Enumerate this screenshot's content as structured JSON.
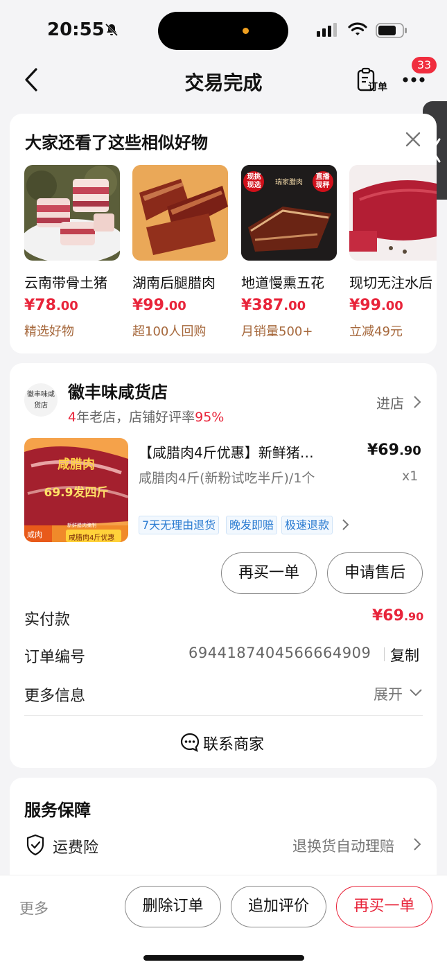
{
  "status_bar": {
    "time": "20:55"
  },
  "header": {
    "title": "交易完成",
    "order_label": "订单",
    "notification_count": "33"
  },
  "recommendations": {
    "title": "大家还看了这些相似好物",
    "items": [
      {
        "name": "云南带骨土猪",
        "price_int": "¥78",
        "price_dec": ".00",
        "tag": "精选好物"
      },
      {
        "name": "湖南后腿腊肉",
        "price_int": "¥99",
        "price_dec": ".00",
        "tag": "超100人回购"
      },
      {
        "name": "地道慢熏五花",
        "price_int": "¥387",
        "price_dec": ".00",
        "tag": "月销量500+",
        "badge_left": "现挑\n现选",
        "badge_mid": "瑞家腊肉",
        "badge_right": "直播\n现秤"
      },
      {
        "name": "现切无注水后",
        "price_int": "¥99",
        "price_dec": ".00",
        "tag": "立减49元"
      }
    ]
  },
  "order": {
    "shop": {
      "logo_text": "徽丰味咸货店",
      "name": "徽丰味咸货店",
      "years": "4",
      "years_text": "年老店，店铺好评率",
      "rating": "95%",
      "enter": "进店"
    },
    "product": {
      "title": "【咸腊肉4斤优惠】新鲜猪…",
      "price_int": "¥69",
      "price_dec": ".90",
      "spec": "咸腊肉4斤(新粉试吃半斤)/1个",
      "qty": "x1",
      "image_caption1": "咸腊肉",
      "image_caption2": "69.9发四斤",
      "image_label_left": "咸肉",
      "image_label_mid": "新鲜腊肉腌制",
      "image_label_right": "咸腊肉4斤优惠",
      "tags": [
        "7天无理由退货",
        "晚发即赔",
        "极速退款"
      ]
    },
    "actions": {
      "rebuy": "再买一单",
      "after_sale": "申请售后"
    },
    "paid_label": "实付款",
    "paid_int": "¥69",
    "paid_dec": ".90",
    "order_no_label": "订单编号",
    "order_no": "6944187404566664909",
    "copy": "复制",
    "more_info_label": "更多信息",
    "expand": "展开",
    "contact": "联系商家"
  },
  "service": {
    "title": "服务保障",
    "item": "运费险",
    "desc": "退换货自动理赔"
  },
  "bottom_bar": {
    "more": "更多",
    "delete": "删除订单",
    "review": "追加评价",
    "rebuy": "再买一单"
  },
  "colors": {
    "accent_red": "#e8243a",
    "tag_blue": "#2a7bd1",
    "recommend_tag": "#a6683c"
  }
}
